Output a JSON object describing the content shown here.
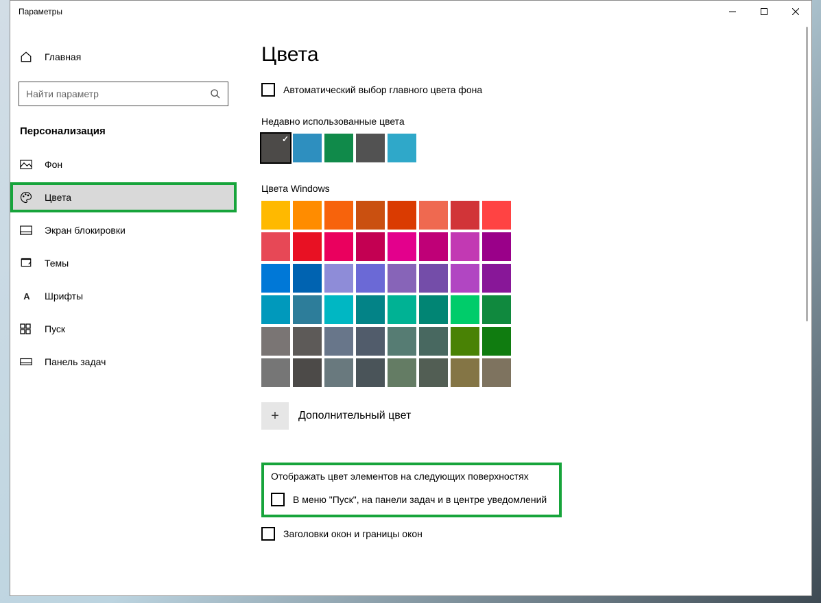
{
  "window": {
    "title": "Параметры"
  },
  "sidebar": {
    "home": "Главная",
    "search_placeholder": "Найти параметр",
    "section": "Персонализация",
    "items": [
      {
        "label": "Фон"
      },
      {
        "label": "Цвета"
      },
      {
        "label": "Экран блокировки"
      },
      {
        "label": "Темы"
      },
      {
        "label": "Шрифты"
      },
      {
        "label": "Пуск"
      },
      {
        "label": "Панель задач"
      }
    ]
  },
  "content": {
    "page_title": "Цвета",
    "auto_pick": "Автоматический выбор главного цвета фона",
    "recent_heading": "Недавно использованные цвета",
    "recent_colors": [
      "#4c4a48",
      "#2e8fbf",
      "#108a4a",
      "#525252",
      "#2fa8c9"
    ],
    "windows_heading": "Цвета Windows",
    "palette": [
      "#ffb900",
      "#ff8c00",
      "#f7630c",
      "#ca5010",
      "#da3b01",
      "#ef6950",
      "#d13438",
      "#ff4343",
      "#e74856",
      "#e81123",
      "#ea005e",
      "#c30052",
      "#e3008c",
      "#bf0077",
      "#c239b3",
      "#9a0089",
      "#0078d7",
      "#0063b1",
      "#8e8cd8",
      "#6b69d6",
      "#8764b8",
      "#744da9",
      "#b146c2",
      "#881798",
      "#0099bc",
      "#2d7d9a",
      "#00b7c3",
      "#038387",
      "#00b294",
      "#018574",
      "#00cc6a",
      "#10893e",
      "#7a7574",
      "#5d5a58",
      "#68768a",
      "#515c6b",
      "#567c73",
      "#486860",
      "#498205",
      "#107c10",
      "#767676",
      "#4c4a48",
      "#69797e",
      "#4a5459",
      "#647c64",
      "#525e54",
      "#847545",
      "#7e735f"
    ],
    "custom_color": "Дополнительный цвет",
    "surfaces_heading": "Отображать цвет элементов на следующих поверхностях",
    "surface_start": "В меню \"Пуск\", на панели задач и в центре уведомлений",
    "surface_titlebars": "Заголовки окон и границы окон"
  }
}
